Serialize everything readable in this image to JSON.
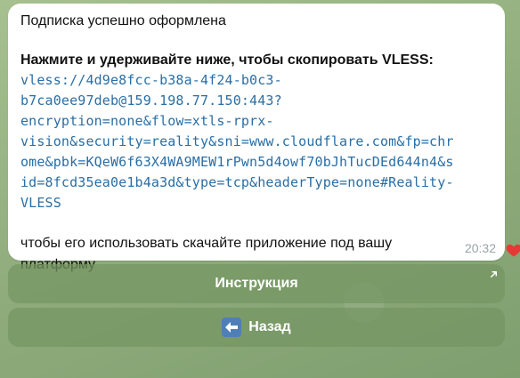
{
  "message": {
    "header": "Подписка успешно оформлена",
    "instruction_bold": "Нажмите и удерживайте ниже, чтобы скопировать VLESS:",
    "code_lines": [
      "vless://4d9e8fcc-b38a-4f24-b0c3-",
      "b7ca0ee97deb@159.198.77.150:443?",
      "encryption=none&flow=xtls-rprx-",
      "vision&security=reality&sni=www.cloudflare.com&fp=chr",
      "ome&pbk=KQeW6f63X4WA9MEW1rPwn5d4owf70bJhTucDEd644n4&s",
      "id=8fcd35ea0e1b4a3d&type=tcp&headerType=none#Reality-",
      "VLESS"
    ],
    "outro": "чтобы его использовать скачайте приложение под вашу платформу",
    "time": "20:32"
  },
  "reaction": {
    "icon": "heart-icon",
    "color": "#e53935"
  },
  "keyboard": {
    "instruction_label": "Инструкция",
    "back_label": "Назад"
  },
  "colors": {
    "link": "#2a6ea5",
    "button_bg": "#749662",
    "back_icon_bg": "#4f7fb7"
  }
}
